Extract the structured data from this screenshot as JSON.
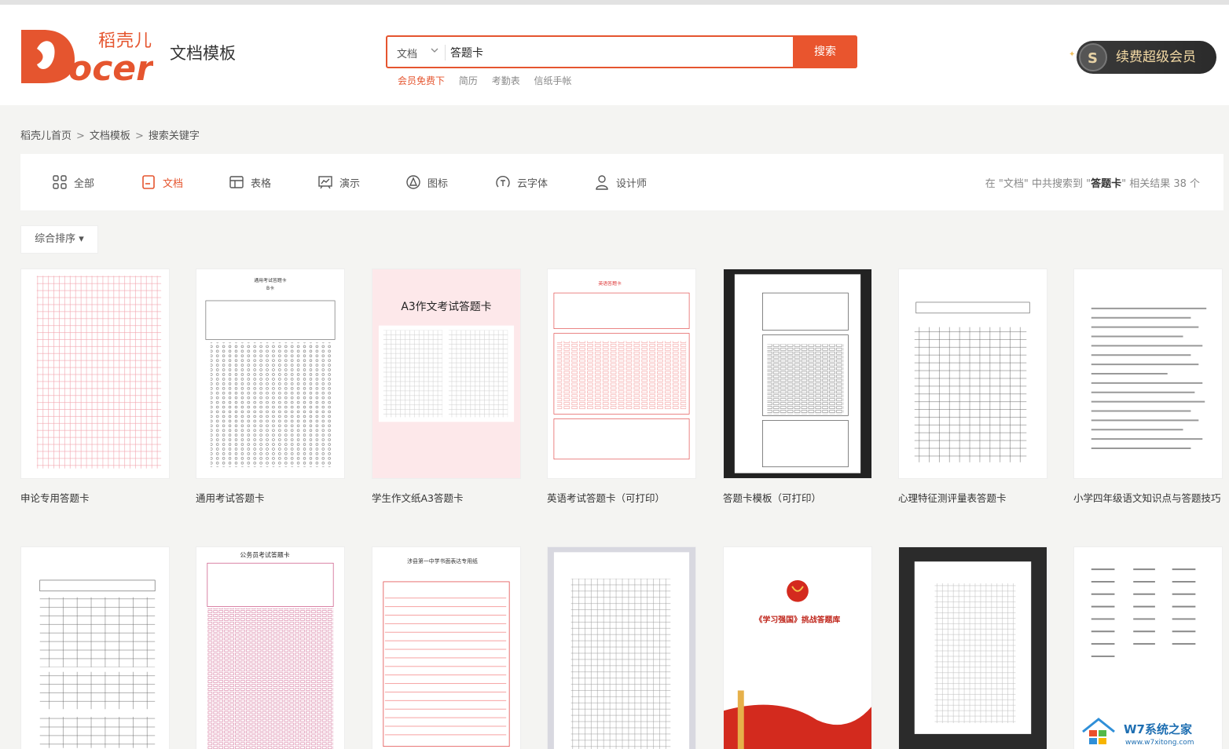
{
  "header": {
    "logo_text": "Docer",
    "logo_sub": "稻壳儿",
    "site_title": "文档模板",
    "search_type": "文档",
    "search_value": "答题卡",
    "search_button": "搜索",
    "hot_words": [
      "会员免费下",
      "简历",
      "考勤表",
      "信纸手帐"
    ],
    "vip_label": "续费超级会员"
  },
  "breadcrumb": [
    "稻壳儿首页",
    "文档模板",
    "搜索关键字"
  ],
  "filters": {
    "tabs": [
      {
        "label": "全部",
        "icon": "grid-icon"
      },
      {
        "label": "文档",
        "icon": "document-icon"
      },
      {
        "label": "表格",
        "icon": "table-icon"
      },
      {
        "label": "演示",
        "icon": "presentation-icon"
      },
      {
        "label": "图标",
        "icon": "icon-icon"
      },
      {
        "label": "云字体",
        "icon": "font-icon"
      },
      {
        "label": "设计师",
        "icon": "user-icon"
      }
    ],
    "active": "文档",
    "result_prefix": "在 \"文档\" 中共搜索到 \"",
    "result_keyword": "答题卡",
    "result_suffix": "\" 相关结果 38 个"
  },
  "sort_label": "综合排序 ▾",
  "cards": [
    {
      "title": "申论专用答题卡"
    },
    {
      "title": "通用考试答题卡"
    },
    {
      "title": "学生作文纸A3答题卡",
      "thumb_heading": "A3作文考试答题卡"
    },
    {
      "title": "英语考试答题卡（可打印）"
    },
    {
      "title": "答题卡模板（可打印）"
    },
    {
      "title": "心理特征测评量表答题卡"
    },
    {
      "title": "小学四年级语文知识点与答题技巧"
    },
    {
      "title": ""
    },
    {
      "title": "",
      "thumb_heading": "公务员考试答题卡"
    },
    {
      "title": "",
      "thumb_heading": "涉县第一中学书面表达专用纸"
    },
    {
      "title": ""
    },
    {
      "title": "",
      "thumb_heading": "《学习强国》挑战答题库"
    },
    {
      "title": ""
    },
    {
      "title": ""
    }
  ],
  "watermark": "W7系统之家",
  "watermark_url": "www.w7xitong.com",
  "colors": {
    "accent": "#e5552f",
    "vip_bg": "#2f2f2f"
  }
}
